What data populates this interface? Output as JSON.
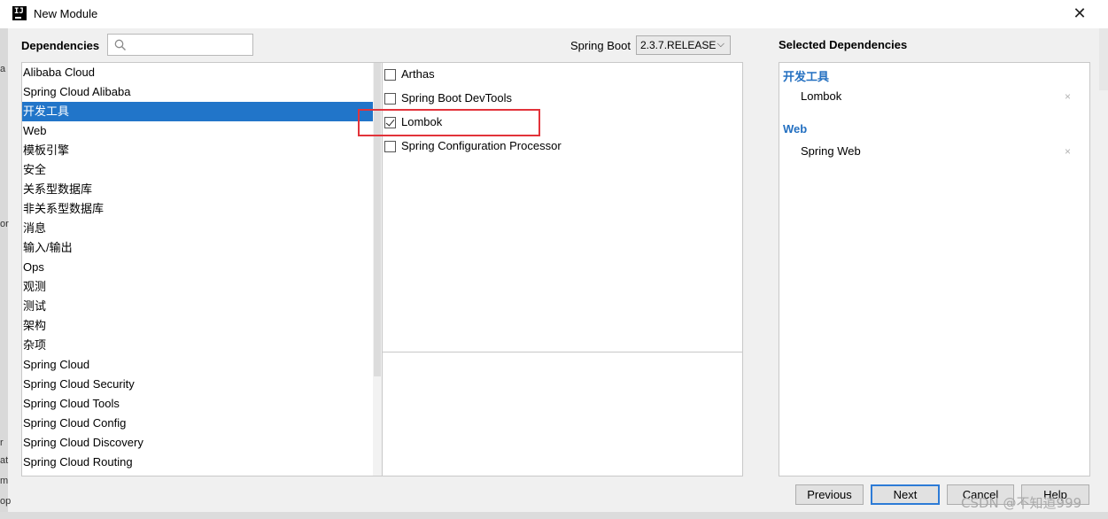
{
  "window": {
    "title": "New Module",
    "icon": "intellij-idea-icon"
  },
  "header": {
    "dependencies_label": "Dependencies",
    "search_placeholder": "",
    "spring_boot_label": "Spring Boot",
    "spring_boot_version": "2.3.7.RELEASE",
    "selected_label": "Selected Dependencies"
  },
  "categories": [
    "Alibaba Cloud",
    "Spring Cloud Alibaba",
    "开发工具",
    "Web",
    "模板引擎",
    "安全",
    "关系型数据库",
    "非关系型数据库",
    "消息",
    "输入/输出",
    "Ops",
    "观测",
    "测试",
    "架构",
    "杂项",
    "Spring Cloud",
    "Spring Cloud Security",
    "Spring Cloud Tools",
    "Spring Cloud Config",
    "Spring Cloud Discovery",
    "Spring Cloud Routing"
  ],
  "selected_category": "开发工具",
  "dependencies": [
    {
      "name": "Arthas",
      "checked": false
    },
    {
      "name": "Spring Boot DevTools",
      "checked": false
    },
    {
      "name": "Lombok",
      "checked": true
    },
    {
      "name": "Spring Configuration Processor",
      "checked": false
    }
  ],
  "selected_groups": [
    {
      "title": "开发工具",
      "items": [
        "Lombok"
      ]
    },
    {
      "title": "Web",
      "items": [
        "Spring Web"
      ]
    }
  ],
  "remove_glyph": "×",
  "buttons": {
    "previous": "Previous",
    "next": "Next",
    "cancel": "Cancel",
    "help": "Help"
  },
  "watermark": "CSDN @不知道999",
  "edge_fragments": [
    "a",
    "or",
    "r",
    "at",
    "m",
    "op"
  ],
  "colors": {
    "selection": "#2175c9",
    "group_title": "#2470c1",
    "highlight": "#e2333a"
  }
}
